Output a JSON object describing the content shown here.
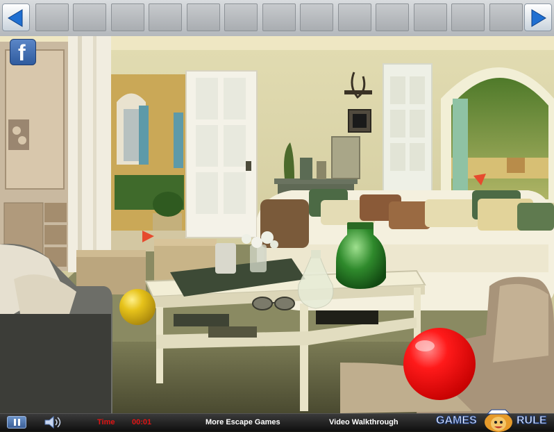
{
  "nav": {
    "left": "arrow-left-icon",
    "right": "arrow-right-icon",
    "slot_count": 13
  },
  "social": {
    "label": "f"
  },
  "bottom": {
    "time_label": "Time",
    "time_value": "00:01",
    "more_games": "More Escape Games",
    "walkthrough": "Video Walkthrough",
    "logo_left": "GAMES",
    "logo_right": "RULE"
  },
  "colors": {
    "accent_blue": "#1f6fd1",
    "timer_red": "#e11414",
    "ball_red": "#ff1010",
    "ball_yellow": "#e6c21a"
  }
}
